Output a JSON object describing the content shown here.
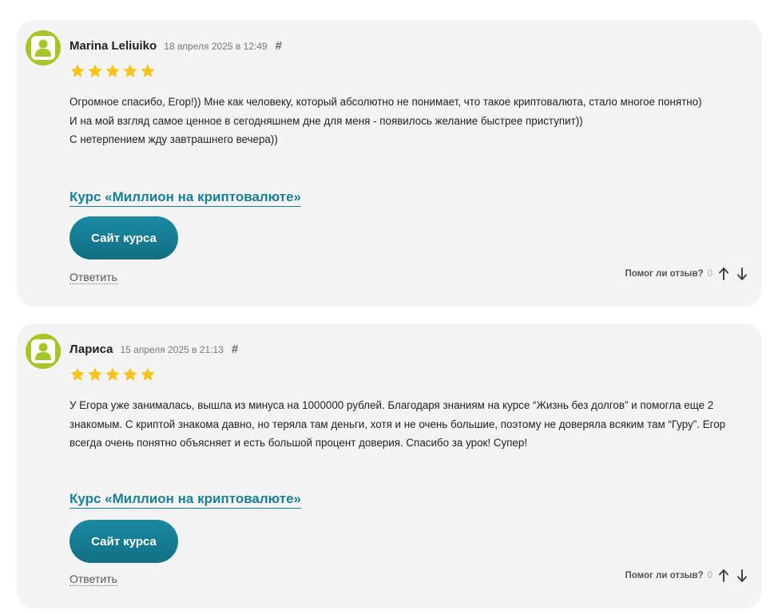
{
  "reviews": [
    {
      "author": "Marina Leliuiko",
      "date": "18 апреля 2025 в 12:49",
      "permalink_symbol": "#",
      "rating": 5,
      "paragraphs": [
        "Огромное спасибо, Егор!)) Мне как человеку, который абсолютно не понимает, что такое криптовалюта, стало многое понятно)",
        "И на мой взгляд самое ценное в сегодняшнем дне для меня - появилось желание быстрее приступит))",
        "С нетерпением жду завтрашнего вечера))"
      ],
      "course_link": "Курс «Миллион на криптовалюте»",
      "site_button": "Сайт курса",
      "reply": "Ответить",
      "helpful_question": "Помог ли отзыв?",
      "helpful_count": "0"
    },
    {
      "author": "Лариса",
      "date": "15 апреля 2025 в 21:13",
      "permalink_symbol": "#",
      "rating": 5,
      "paragraphs": [
        "У Егора уже занималась, вышла из минуса на 1000000 рублей. Благодаря знаниям на курсе “Жизнь без долгов” и помогла еще 2 знакомым. С криптой знакома давно, но теряла там деньги, хотя и не очень большие, поэтому не доверяла всяким там “Гуру”. Егор всегда очень понятно объясняет и есть большой процент доверия. Спасибо за урок! Супер!"
      ],
      "course_link": "Курс «Миллион на криптовалюте»",
      "site_button": "Сайт курса",
      "reply": "Ответить",
      "helpful_question": "Помог ли отзыв?",
      "helpful_count": "0"
    }
  ],
  "icons": {
    "avatar": "user-silhouette-icon",
    "star": "star-icon",
    "vote_up": "arrow-up-icon",
    "vote_down": "arrow-down-icon"
  },
  "colors": {
    "card_background": "#f4f4f4",
    "avatar_green": "#a8c528",
    "star_gold": "#f7c21a",
    "link_teal": "#188096",
    "button_teal": "#157b91"
  }
}
